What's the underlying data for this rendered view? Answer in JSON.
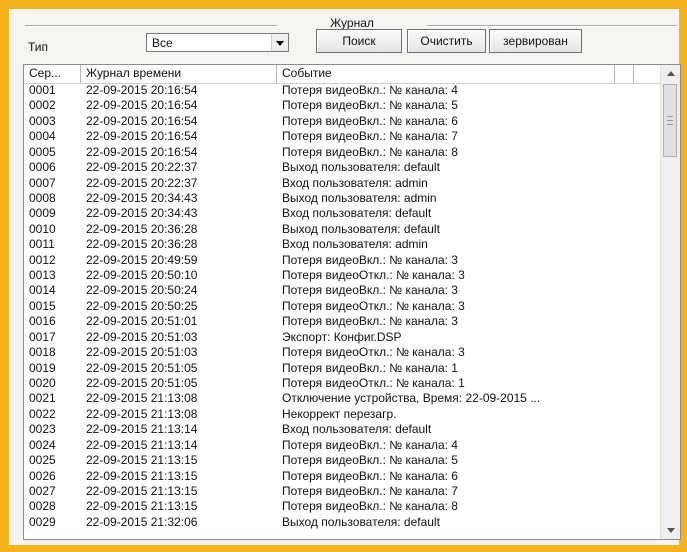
{
  "group": {
    "title": "Журнал"
  },
  "filter": {
    "type_label": "Тип",
    "type_value": "Все",
    "search_label": "Поиск",
    "clear_label": "Очистить",
    "reserved_label": "зервирован"
  },
  "table": {
    "headers": [
      "Сер...",
      "Журнал времени",
      "Событие",
      ""
    ],
    "rows": [
      [
        "0001",
        "22-09-2015 20:16:54",
        "Потеря видеоВкл.: № канала: 4"
      ],
      [
        "0002",
        "22-09-2015 20:16:54",
        "Потеря видеоВкл.: № канала: 5"
      ],
      [
        "0003",
        "22-09-2015 20:16:54",
        "Потеря видеоВкл.: № канала: 6"
      ],
      [
        "0004",
        "22-09-2015 20:16:54",
        "Потеря видеоВкл.: № канала: 7"
      ],
      [
        "0005",
        "22-09-2015 20:16:54",
        "Потеря видеоВкл.: № канала: 8"
      ],
      [
        "0006",
        "22-09-2015 20:22:37",
        "Выход пользователя: default"
      ],
      [
        "0007",
        "22-09-2015 20:22:37",
        "Вход пользователя: admin"
      ],
      [
        "0008",
        "22-09-2015 20:34:43",
        "Выход пользователя: admin"
      ],
      [
        "0009",
        "22-09-2015 20:34:43",
        "Вход пользователя: default"
      ],
      [
        "0010",
        "22-09-2015 20:36:28",
        "Выход пользователя: default"
      ],
      [
        "0011",
        "22-09-2015 20:36:28",
        "Вход пользователя: admin"
      ],
      [
        "0012",
        "22-09-2015 20:49:59",
        "Потеря видеоВкл.: № канала: 3"
      ],
      [
        "0013",
        "22-09-2015 20:50:10",
        "Потеря видеоОткл.: № канала: 3"
      ],
      [
        "0014",
        "22-09-2015 20:50:24",
        "Потеря видеоВкл.: № канала: 3"
      ],
      [
        "0015",
        "22-09-2015 20:50:25",
        "Потеря видеоОткл.: № канала: 3"
      ],
      [
        "0016",
        "22-09-2015 20:51:01",
        "Потеря видеоВкл.: № канала: 3"
      ],
      [
        "0017",
        "22-09-2015 20:51:03",
        "Экспорт: Конфиг.DSP"
      ],
      [
        "0018",
        "22-09-2015 20:51:03",
        "Потеря видеоОткл.: № канала: 3"
      ],
      [
        "0019",
        "22-09-2015 20:51:05",
        "Потеря видеоВкл.: № канала: 1"
      ],
      [
        "0020",
        "22-09-2015 20:51:05",
        "Потеря видеоОткл.: № канала: 1"
      ],
      [
        "0021",
        "22-09-2015 21:13:08",
        "Отключение устройства, Время: 22-09-2015 ..."
      ],
      [
        "0022",
        "22-09-2015 21:13:08",
        "Некоррект перезагр."
      ],
      [
        "0023",
        "22-09-2015 21:13:14",
        "Вход пользователя: default"
      ],
      [
        "0024",
        "22-09-2015 21:13:14",
        "Потеря видеоВкл.: № канала: 4"
      ],
      [
        "0025",
        "22-09-2015 21:13:15",
        "Потеря видеоВкл.: № канала: 5"
      ],
      [
        "0026",
        "22-09-2015 21:13:15",
        "Потеря видеоВкл.: № канала: 6"
      ],
      [
        "0027",
        "22-09-2015 21:13:15",
        "Потеря видеоВкл.: № канала: 7"
      ],
      [
        "0028",
        "22-09-2015 21:13:15",
        "Потеря видеоВкл.: № канала: 8"
      ],
      [
        "0029",
        "22-09-2015 21:32:06",
        "Выход пользователя: default"
      ]
    ]
  },
  "icons": {
    "dropdown": "chevron-down-icon",
    "scroll_up": "arrow-up-icon",
    "scroll_down": "arrow-down-icon",
    "grip": "grip-icon"
  },
  "colors": {
    "frame_border": "#f5b320",
    "panel_background": "#f5f4f1"
  }
}
